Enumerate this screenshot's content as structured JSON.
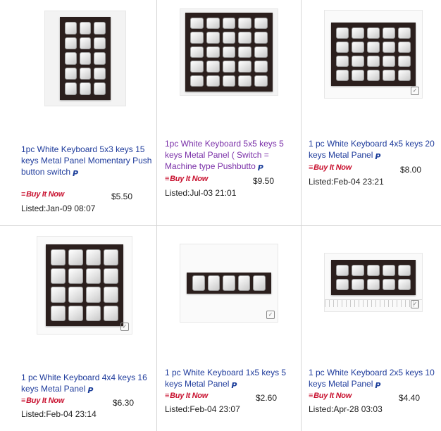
{
  "listings": [
    {
      "title": "1pc White Keyboard 5x3 keys 15 keys Metal Panel Momentary Push button switch",
      "price": "$5.50",
      "listed": "Listed:Jan-09 08:07",
      "buy_it_now": "Buy It Now",
      "paypal": true,
      "visited": false,
      "keypad_rows": 5,
      "keypad_cols": 3
    },
    {
      "title": "1pc White Keyboard 5x5 keys 5 keys Metal Panel ( Switch = Machine type Pushbutto",
      "price": "$9.50",
      "listed": "Listed:Jul-03 21:01",
      "buy_it_now": "Buy It Now",
      "paypal": true,
      "visited": true,
      "keypad_rows": 5,
      "keypad_cols": 5
    },
    {
      "title": "1 pc White Keyboard 4x5 keys 20 keys Metal Panel",
      "price": "$8.00",
      "listed": "Listed:Feb-04 23:21",
      "buy_it_now": "Buy It Now",
      "paypal": true,
      "visited": false,
      "keypad_rows": 4,
      "keypad_cols": 5
    },
    {
      "title": "1 pc White Keyboard 4x4 keys 16 keys Metal Panel",
      "price": "$6.30",
      "listed": "Listed:Feb-04 23:14",
      "buy_it_now": "Buy It Now",
      "paypal": true,
      "visited": false,
      "keypad_rows": 4,
      "keypad_cols": 4
    },
    {
      "title": "1 pc White Keyboard 1x5 keys 5 keys Metal Panel",
      "price": "$2.60",
      "listed": "Listed:Feb-04 23:07",
      "buy_it_now": "Buy It Now",
      "paypal": true,
      "visited": false,
      "keypad_rows": 1,
      "keypad_cols": 5
    },
    {
      "title": "1 pc White Keyboard 2x5 keys 10 keys Metal Panel",
      "price": "$4.40",
      "listed": "Listed:Apr-28 03:03",
      "buy_it_now": "Buy It Now",
      "paypal": true,
      "visited": false,
      "keypad_rows": 2,
      "keypad_cols": 5
    }
  ],
  "colors": {
    "link": "#1f3c9c",
    "visited_link": "#7a2fa8",
    "buy_it_now": "#c8102e",
    "paypal": "#1c3e9a"
  },
  "icons": {
    "paypal": "paypal-icon",
    "buy_it_now": "buy-it-now-icon"
  }
}
